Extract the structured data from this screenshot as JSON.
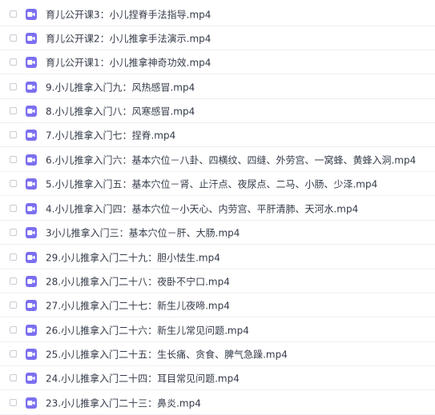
{
  "icon": "video-file-icon",
  "accent_color": "#7b6ff0",
  "files": [
    {
      "name": "育儿公开课3：小儿捏脊手法指导.mp4"
    },
    {
      "name": "育儿公开课2：小儿推拿手法演示.mp4"
    },
    {
      "name": "育儿公开课1：小儿推拿神奇功效.mp4"
    },
    {
      "name": "9.小儿推拿入门九：风热感冒.mp4"
    },
    {
      "name": "8.小儿推拿入门八：风寒感冒.mp4"
    },
    {
      "name": "7.小儿推拿入门七：捏脊.mp4"
    },
    {
      "name": "6.小儿推拿入门六：基本穴位－八卦、四横纹、四缝、外劳宫、一窝蜂、黄蜂入洞.mp4"
    },
    {
      "name": "5.小儿推拿入门五：基本穴位－肾、止汗点、夜尿点、二马、小肠、少泽.mp4"
    },
    {
      "name": "4.小儿推拿入门四：基本穴位－小天心、内劳宫、平肝清肺、天河水.mp4"
    },
    {
      "name": "3小儿推拿入门三：基本穴位－肝、大肠.mp4"
    },
    {
      "name": "29.小儿推拿入门二十九：胆小怯生.mp4"
    },
    {
      "name": "28.小儿推拿入门二十八：夜卧不宁口.mp4"
    },
    {
      "name": "27.小儿推拿入门二十七：新生儿夜啼.mp4"
    },
    {
      "name": "26.小儿推拿入门二十六：新生儿常见问题.mp4"
    },
    {
      "name": "25.小儿推拿入门二十五：生长痛、贪食、脾气急躁.mp4"
    },
    {
      "name": "24.小儿推拿入门二十四：耳目常见问题.mp4"
    },
    {
      "name": "23.小儿推拿入门二十三：鼻炎.mp4"
    }
  ]
}
